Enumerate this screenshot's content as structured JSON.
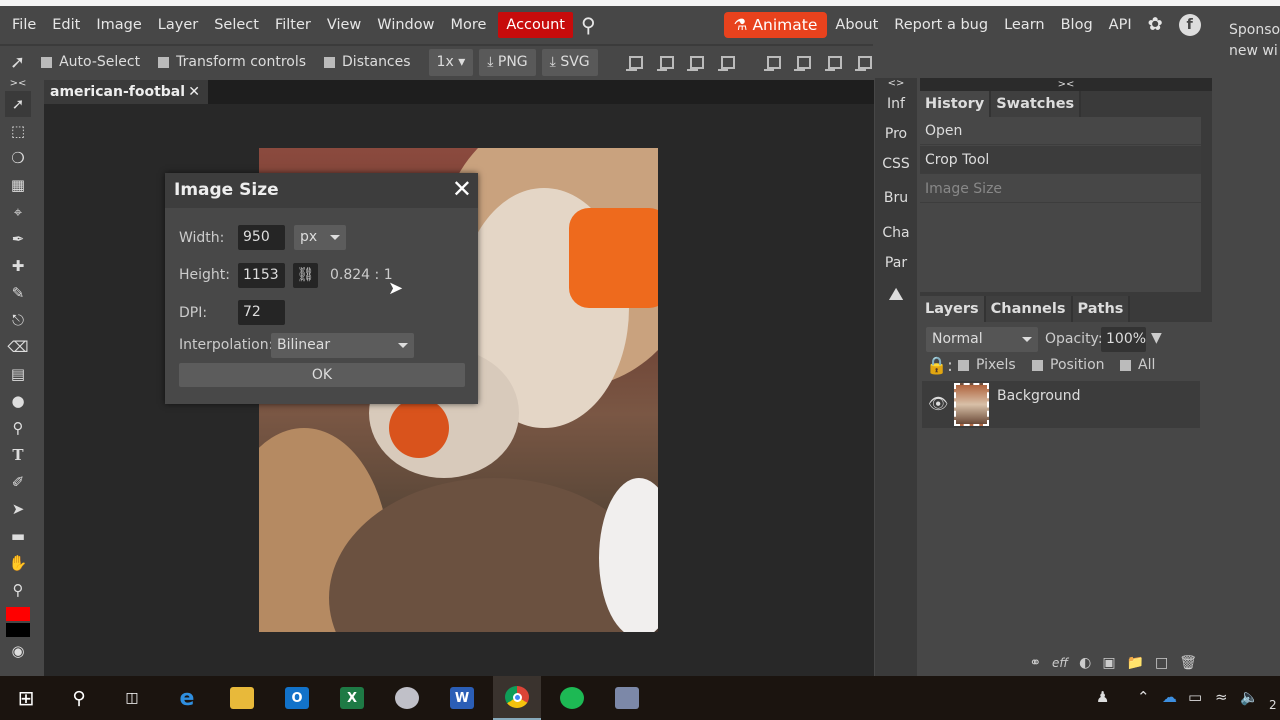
{
  "menu": {
    "items": [
      "File",
      "Edit",
      "Image",
      "Layer",
      "Select",
      "Filter",
      "View",
      "Window",
      "More"
    ],
    "account": "Account",
    "animate": "Animate",
    "links": [
      "About",
      "Report a bug",
      "Learn",
      "Blog",
      "API"
    ]
  },
  "sponsor": {
    "line1": "Sponso",
    "line2": "new wi"
  },
  "options": {
    "auto_select": "Auto-Select",
    "transform": "Transform controls",
    "distances": "Distances",
    "scale": "1x",
    "png": "PNG",
    "svg": "SVG"
  },
  "document": {
    "tab": "american-footbal"
  },
  "dialog": {
    "title": "Image Size",
    "width_label": "Width:",
    "width": "950",
    "unit": "px",
    "height_label": "Height:",
    "height": "1153",
    "ratio": "0.824 : 1",
    "dpi_label": "DPI:",
    "dpi": "72",
    "interp_label": "Interpolation:",
    "interp": "Bilinear",
    "ok": "OK"
  },
  "mini_panel": [
    "Inf",
    "Pro",
    "CSS",
    "Bru",
    "Cha",
    "Par"
  ],
  "history": {
    "tabs": [
      "History",
      "Swatches"
    ],
    "items": [
      "Open",
      "Crop Tool",
      "Image Size"
    ]
  },
  "layers": {
    "tabs": [
      "Layers",
      "Channels",
      "Paths"
    ],
    "blend": "Normal",
    "opacity_label": "Opacity:",
    "opacity": "100%",
    "lock_pixels": "Pixels",
    "lock_position": "Position",
    "lock_all": "All",
    "layer_name": "Background",
    "eff": "eff"
  },
  "colors": {
    "accent_account": "#c70b0b",
    "accent_animate": "#e8421d",
    "foreground": "#ff0000",
    "background": "#000000"
  },
  "taskbar": {
    "clock_partial": "2"
  }
}
